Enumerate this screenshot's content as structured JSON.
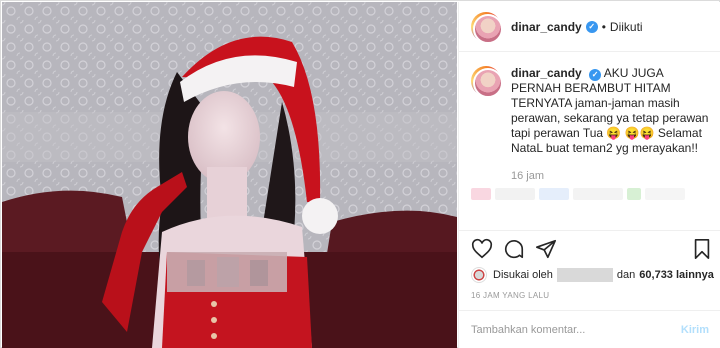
{
  "post": {
    "username": "dinar_candy",
    "follow_status": "Diikuti",
    "caption_text": "AKU JUGA PERNAH BERAMBUT HITAM TERNYATA jaman-jaman masih perawan, sekarang ya tetap perawan tapi perawan Tua 😝 😝😝 Selamat NataL buat teman2 yg merayakan!!",
    "caption_time": "16 jam",
    "likes_prefix": "Disukai oleh",
    "likes_suffix": "dan",
    "likes_count": "60,733 lainnya",
    "post_time": "16 JAM YANG LALU",
    "comment_placeholder": "Tambahkan komentar...",
    "post_button": "Kirim"
  },
  "icons": {
    "verified": "verified-badge-icon",
    "like": "heart-icon",
    "comment": "comment-icon",
    "share": "share-icon",
    "save": "bookmark-icon"
  },
  "colors": {
    "verified_blue": "#3897f0",
    "post_button_disabled": "#b2dffc",
    "meta_gray": "#999999"
  }
}
